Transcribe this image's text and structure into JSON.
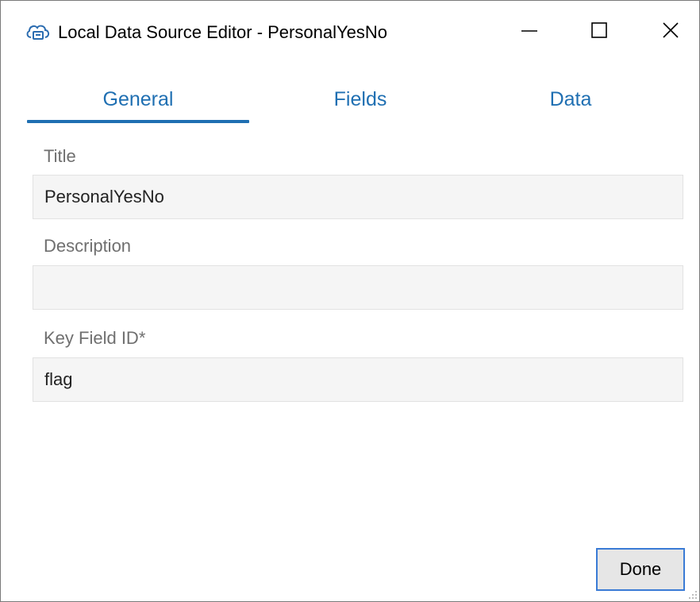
{
  "window": {
    "title": "Local Data Source Editor - PersonalYesNo",
    "app_icon": "cloud-icon",
    "controls": {
      "minimize_icon": "minimize-icon",
      "maximize_icon": "maximize-icon",
      "close_icon": "close-icon"
    }
  },
  "tabs": [
    {
      "label": "General",
      "selected": true
    },
    {
      "label": "Fields",
      "selected": false
    },
    {
      "label": "Data",
      "selected": false
    }
  ],
  "form": {
    "title": {
      "label": "Title",
      "value": "PersonalYesNo"
    },
    "description": {
      "label": "Description",
      "value": ""
    },
    "key_field": {
      "label": "Key Field ID*",
      "value": "flag"
    }
  },
  "footer": {
    "done_label": "Done"
  },
  "colors": {
    "accent": "#1f6fb2",
    "label_gray": "#6f6f6f",
    "input_bg": "#f5f5f5"
  }
}
